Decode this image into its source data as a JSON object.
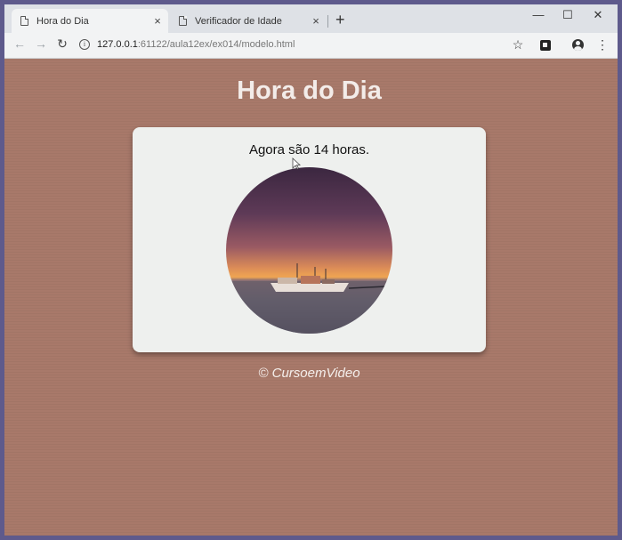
{
  "browser": {
    "tabs": [
      {
        "title": "Hora do Dia",
        "close": "×"
      },
      {
        "title": "Verificador de Idade",
        "close": "×"
      }
    ],
    "new_tab": "+",
    "window_controls": {
      "minimize": "—",
      "maximize": "☐",
      "close": "✕"
    },
    "nav": {
      "back": "←",
      "forward": "→",
      "reload": "↻"
    },
    "url": {
      "host": "127.0.0.1",
      "rest": ":61122/aula12ex/ex014/modelo.html"
    },
    "star": "☆",
    "menu": "⋮"
  },
  "page": {
    "title": "Hora do Dia",
    "message": "Agora são 14 horas.",
    "footer": "© CursoemVideo"
  },
  "colors": {
    "page_background": "#a8796a",
    "card_background": "#eef0ee",
    "title_color": "#f3ece9"
  }
}
